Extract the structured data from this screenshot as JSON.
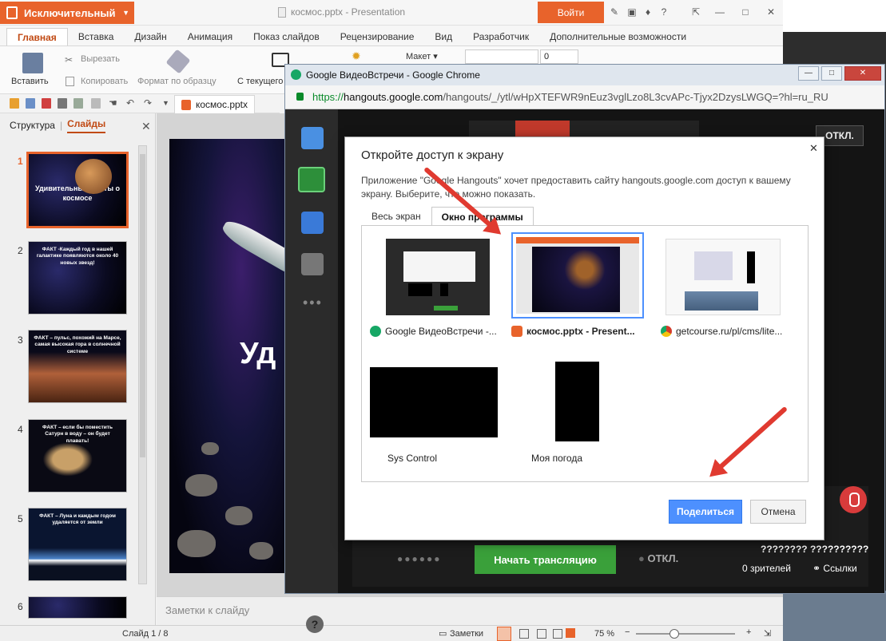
{
  "app": {
    "brand": "Исключительный",
    "doc_title": "космос.pptx - Presentation",
    "login": "Войти",
    "menu": [
      "Главная",
      "Вставка",
      "Дизайн",
      "Анимация",
      "Показ слайдов",
      "Рецензирование",
      "Вид",
      "Разработчик",
      "Дополнительные возможности"
    ],
    "ribbon": {
      "paste": "Вставить",
      "cut": "Вырезать",
      "copy": "Копировать",
      "format_painter": "Формат по образцу",
      "from_current": "С текущего",
      "layout": "Макет",
      "font_size": "0"
    },
    "file_tab": "космос.pptx",
    "left_panel": {
      "tab_structure": "Структура",
      "tab_slides": "Слайды",
      "slides": [
        {
          "num": "1",
          "text": "Удивительные факты о космосе"
        },
        {
          "num": "2",
          "text": "ФАКТ -Каждый год в нашей галактике появляются около 40 новых звезд!"
        },
        {
          "num": "3",
          "text": "ФАКТ – пульс, похожий на Марсе, самая высокая гора в солнечной системе"
        },
        {
          "num": "4",
          "text": "ФАКТ – если бы поместить Сатурн в воду – он будет плавать!"
        },
        {
          "num": "5",
          "text": "ФАКТ – Луна и каждым годом удаляется от земли"
        },
        {
          "num": "6",
          "text": ""
        }
      ]
    },
    "slide_title_fragment": "Уд",
    "notes_placeholder": "Заметки к слайду",
    "status": {
      "slide_counter": "Слайд 1 / 8",
      "notes": "Заметки",
      "zoom": "75 %"
    }
  },
  "chrome": {
    "title": "Google ВидеоВстречи - Google Chrome",
    "url_prefix": "https://",
    "url_host": "hangouts.google.com",
    "url_rest": "/hangouts/_/ytl/wHpXTEFWR9nEuz3vglLzo8L3cvAPc-Tjyx2DzysLWGQ=?hl=ru_RU",
    "hangout": {
      "off_button": "ОТКЛ.",
      "start_broadcast": "Начать трансляцию",
      "dots": "●●●●●●",
      "off_label": "ОТКЛ.",
      "question_marks": "???????? ??????????",
      "viewers": "0 зрителей",
      "links": "Ссылки",
      "help": "?"
    }
  },
  "dialog": {
    "title": "Откройте доступ к экрану",
    "description": "Приложение \"Google Hangouts\" хочет предоставить сайту hangouts.google.com доступ к вашему экрану. Выберите, что можно показать.",
    "tab_full": "Весь экран",
    "tab_window": "Окно программы",
    "windows": [
      {
        "label": "Google ВидеоВстречи -...",
        "icon_color": "#16a765"
      },
      {
        "label": "космос.pptx - Present...",
        "icon_color": "#e8632b"
      },
      {
        "label": "getcourse.ru/pl/cms/lite...",
        "icon_color": "#d33b2c"
      },
      {
        "label": "Sys Control"
      },
      {
        "label": "Моя погода"
      }
    ],
    "share": "Поделиться",
    "cancel": "Отмена"
  }
}
